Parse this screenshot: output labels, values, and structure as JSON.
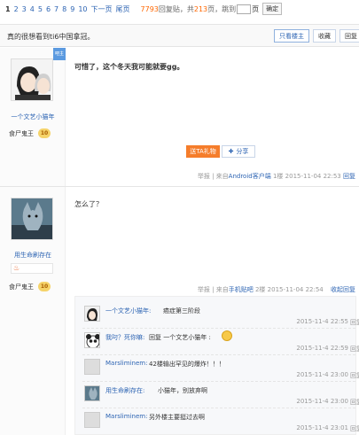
{
  "pager": {
    "pages": [
      "1",
      "2",
      "3",
      "4",
      "5",
      "6",
      "7",
      "8",
      "9",
      "10"
    ],
    "next": "下一页",
    "last": "尾页",
    "reply_count": "7793",
    "reply_label": "回复贴，共",
    "page_total": "213",
    "page_label": "页，跳到",
    "page_unit": "页",
    "confirm": "确定"
  },
  "thread": {
    "title": "真的很想看到ti6中国拿冠。",
    "only_op": "只看楼主",
    "favorite": "收藏",
    "reply": "回复"
  },
  "post1": {
    "author": "一个文艺小猫年",
    "corner": "吧主",
    "badge": "食尸鬼王",
    "level": "10",
    "content": "可惜了，这个冬天我可能就要gg。",
    "gift": "送TA礼物",
    "share": "分享",
    "report": "举报",
    "source_prefix": "| 来自",
    "source": "Android客户端",
    "floor": "1楼",
    "time": "2015-11-04 22:53",
    "reply": "回复"
  },
  "post2": {
    "author": "用生命刷存在",
    "badge": "食尸鬼王",
    "level": "10",
    "content": "怎么了？",
    "report": "举报",
    "source_prefix": "| 来自",
    "source": "手机贴吧",
    "floor": "2楼",
    "time": "2015-11-04 22:54",
    "collapse": "收起回复"
  },
  "sub_replies": [
    {
      "name": "一个文艺小猫年:",
      "text": "癌症第三阶段",
      "time": "2015-11-4 22:55",
      "reply": "回复"
    },
    {
      "name": "我叼？死你嘛:",
      "text": "回复 一个文艺小猫年 :",
      "time": "2015-11-4 22:59",
      "reply": "回复"
    },
    {
      "name": "Marsliminem:",
      "text": "42楼输出罕见的爆炸！！！",
      "time": "2015-11-4 23:00",
      "reply": "回复"
    },
    {
      "name": "用生命刷存在:",
      "text": "小猫年，别放弃啊",
      "time": "2015-11-4 23:00",
      "reply": "回复"
    },
    {
      "name": "Marsliminem:",
      "text": "另外楼主要挺过去啊",
      "time": "2015-11-4 23:01",
      "reply": "回复"
    }
  ],
  "colors": {
    "link": "#2d64b3",
    "accent_orange": "#f57d2b",
    "count": "#ff6600"
  }
}
